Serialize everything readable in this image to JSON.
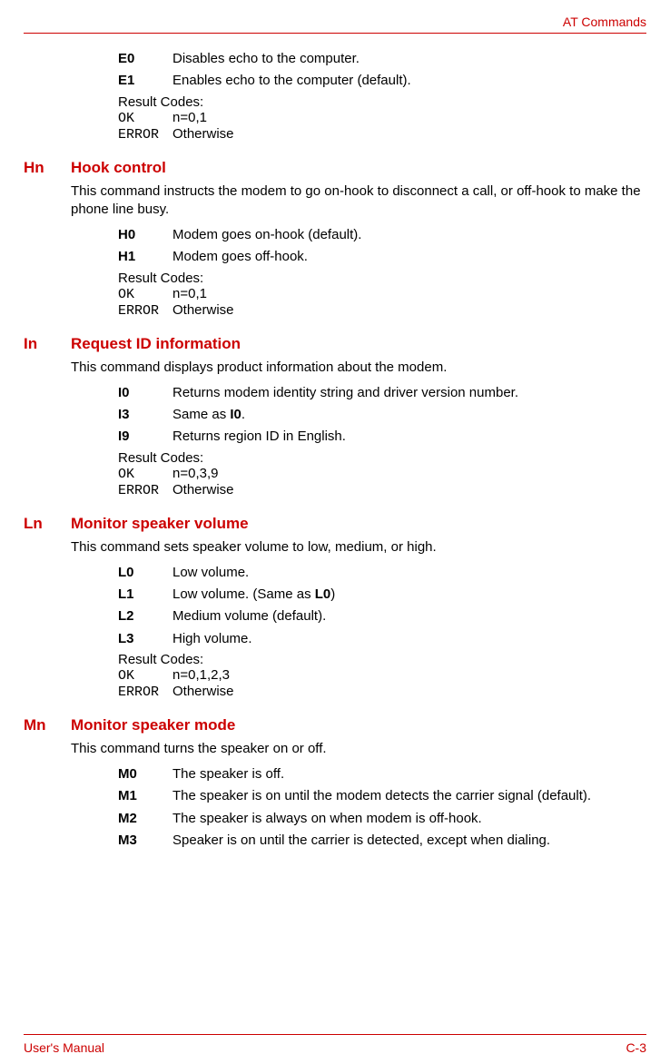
{
  "header": {
    "title": "AT Commands"
  },
  "footer": {
    "left": "User's Manual",
    "right": "C-3"
  },
  "preRows": [
    {
      "code": "E0",
      "desc": "Disables echo to the computer."
    },
    {
      "code": "E1",
      "desc": "Enables echo to the computer (default)."
    }
  ],
  "preResult": {
    "label": "Result Codes:",
    "ok": "OK",
    "okVal": "n=0,1",
    "err": "ERROR",
    "errVal": "Otherwise"
  },
  "sections": {
    "hn": {
      "code": "Hn",
      "title": "Hook control",
      "para": "This command instructs the modem to go on-hook to disconnect a call, or off-hook to make the phone line busy.",
      "rows": [
        {
          "code": "H0",
          "desc": "Modem goes on-hook (default)."
        },
        {
          "code": "H1",
          "desc": "Modem goes off-hook."
        }
      ],
      "result": {
        "label": "Result Codes:",
        "ok": "OK",
        "okVal": "n=0,1",
        "err": "ERROR",
        "errVal": "Otherwise"
      }
    },
    "in": {
      "code": "In",
      "title": "Request ID information",
      "para": "This command displays product information about the modem.",
      "rows": [
        {
          "code": "I0",
          "desc": "Returns modem identity string and driver version number."
        },
        {
          "code": "I3",
          "descPre": "Same as ",
          "descBold": "I0",
          "descPost": "."
        },
        {
          "code": "I9",
          "desc": "Returns region ID in English."
        }
      ],
      "result": {
        "label": "Result Codes:",
        "ok": "OK",
        "okVal": "n=0,3,9",
        "err": "ERROR",
        "errVal": "Otherwise"
      }
    },
    "ln": {
      "code": "Ln",
      "title": "Monitor speaker volume",
      "para": "This command sets speaker volume to low, medium, or high.",
      "rows": [
        {
          "code": "L0",
          "desc": "Low volume."
        },
        {
          "code": "L1",
          "descPre": "Low volume. (Same as ",
          "descBold": "L0",
          "descPost": ")"
        },
        {
          "code": "L2",
          "desc": "Medium volume (default)."
        },
        {
          "code": "L3",
          "desc": "High volume."
        }
      ],
      "result": {
        "label": "Result Codes:",
        "ok": "OK",
        "okVal": "n=0,1,2,3",
        "err": "ERROR",
        "errVal": "Otherwise"
      }
    },
    "mn": {
      "code": "Mn",
      "title": "Monitor speaker mode",
      "para": "This command turns the speaker on or off.",
      "rows": [
        {
          "code": "M0",
          "desc": "The speaker is off."
        },
        {
          "code": "M1",
          "desc": "The speaker is on until the modem detects the carrier signal (default)."
        },
        {
          "code": "M2",
          "desc": "The speaker is always on when modem is off-hook."
        },
        {
          "code": "M3",
          "desc": "Speaker is on until the carrier is detected, except when dialing."
        }
      ]
    }
  }
}
